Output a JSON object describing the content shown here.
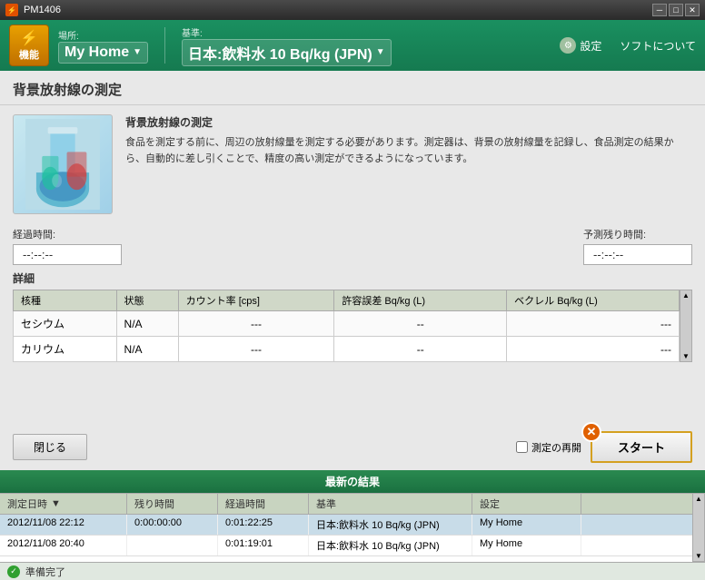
{
  "titleBar": {
    "title": "PM1406",
    "minBtn": "─",
    "maxBtn": "□",
    "closeBtn": "✕"
  },
  "header": {
    "functionBtn": "機能",
    "locationLabel": "場所:",
    "locationValue": "My Home",
    "standardLabel": "基準:",
    "standardValue": "日本:飲料水 10 Bq/kg (JPN)",
    "settingsLabel": "設定",
    "aboutLabel": "ソフトについて"
  },
  "mainSection": {
    "title": "背景放射線の測定",
    "descriptionTitle": "背景放射線の測定",
    "descriptionText": "食品を測定する前に、周辺の放射線量を測定する必要があります。測定器は、背景の放射線量を記録し、食品測定の結果から、自動的に差し引くことで、精度の高い測定ができるようになっています。",
    "elapsedLabel": "経過時間:",
    "elapsedValue": "--:--:--",
    "remainingLabel": "予測残り時間:",
    "remainingValue": "--:--:--",
    "detailsTitle": "詳細",
    "tableHeaders": [
      "核種",
      "状態",
      "カウント率 [cps]",
      "許容誤差 Bq/kg (L)",
      "ベクレル Bq/kg (L)"
    ],
    "tableRows": [
      {
        "nuclide": "セシウム",
        "status": "N/A",
        "countRate": "---",
        "tolerance": "--",
        "becquerel": "---"
      },
      {
        "nuclide": "カリウム",
        "status": "N/A",
        "countRate": "---",
        "tolerance": "--",
        "becquerel": "---"
      }
    ],
    "closeBtn": "閉じる",
    "remeasureLabel": "測定の再開",
    "startBtn": "スタート",
    "xBtn": "✕"
  },
  "results": {
    "title": "最新の結果",
    "headers": [
      "測定日時",
      "残り時間",
      "経過時間",
      "基準",
      "設定"
    ],
    "sortArrow": "▼",
    "rows": [
      {
        "datetime": "2012/11/08 22:12",
        "remaining": "0:00:00:00",
        "elapsed": "0:01:22:25",
        "standard": "日本:飲料水 10 Bq/kg (JPN)",
        "setting": "My Home"
      },
      {
        "datetime": "2012/11/08 20:40",
        "remaining": "",
        "elapsed": "0:01:19:01",
        "standard": "日本:飲料水 10 Bq/kg (JPN)",
        "setting": "My Home"
      }
    ]
  },
  "statusBar": {
    "icon": "✓",
    "text": "準備完了"
  }
}
